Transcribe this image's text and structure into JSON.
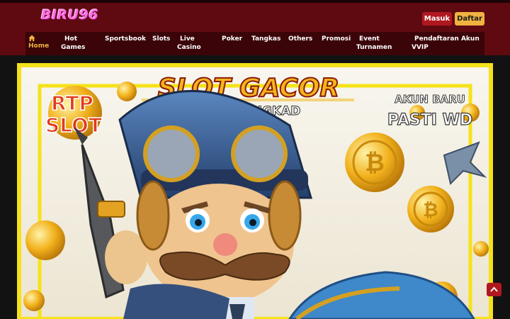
{
  "header": {
    "logo_text": "BIRU96",
    "login_label": "Masuk",
    "register_label": "Daftar"
  },
  "nav": {
    "items": [
      {
        "line1": "",
        "line2": "Home"
      },
      {
        "line1": "Hot",
        "line2": "Games"
      },
      {
        "line1": "Sportsbook",
        "line2": ""
      },
      {
        "line1": "Slots",
        "line2": ""
      },
      {
        "line1": "Live",
        "line2": "Casino"
      },
      {
        "line1": "Poker",
        "line2": ""
      },
      {
        "line1": "Tangkas",
        "line2": ""
      },
      {
        "line1": "Others",
        "line2": ""
      },
      {
        "line1": "Promosi",
        "line2": ""
      },
      {
        "line1": "Event",
        "line2": "Turnamen"
      },
      {
        "line1": "Pendaftaran Akun",
        "line2": "VVIP"
      }
    ]
  },
  "banner": {
    "title": "SLOT GACOR",
    "subtitle": "ANTI RUNGKAD",
    "left_badge": [
      "RTP",
      "SLOT"
    ],
    "right_badge": [
      "AKUN BARU",
      "PASTI WD"
    ]
  },
  "colors": {
    "header_bg": "#5e0a10",
    "nav_bg": "#3a0408",
    "accent_gold": "#f0b340",
    "button_red": "#b01820",
    "logo_pink": "#ff6fe0",
    "page_bg": "#121212",
    "banner_frame": "#f5e21a"
  },
  "icons": {
    "home": "home-icon",
    "scroll_top": "chevron-up-icon"
  }
}
